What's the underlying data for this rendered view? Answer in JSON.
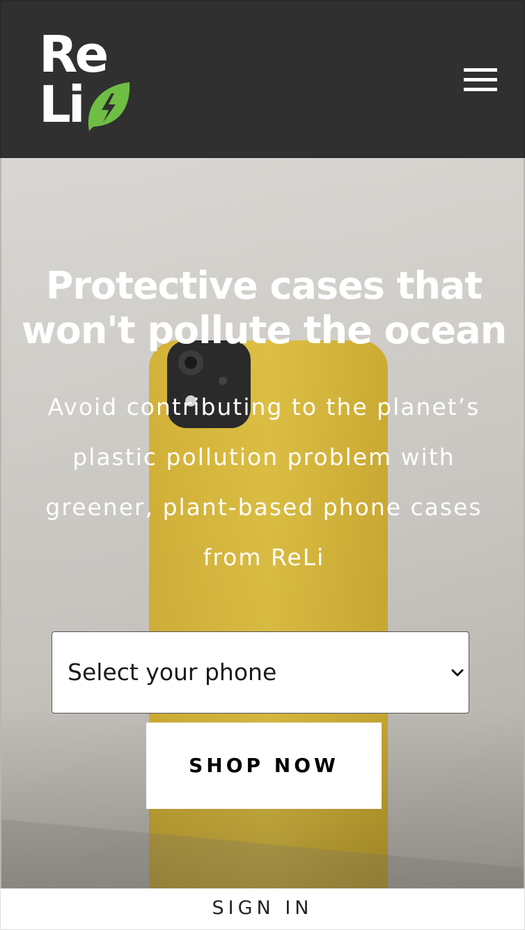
{
  "header": {
    "logo": {
      "line1": "Re",
      "line2": "Li",
      "accent_color": "#6fbe44"
    },
    "menu_icon": "hamburger-menu-icon",
    "background_color": "#303030"
  },
  "hero": {
    "title": "Protective cases that won't pollute the ocean",
    "text": "Avoid contributing to the planet’s plastic pollution problem with greener, plant-based phone cases from ReLi",
    "select": {
      "selected": "Select your phone",
      "icon": "chevron-down-icon"
    },
    "shop_button": "SHOP NOW"
  },
  "footer": {
    "sign_in": "SIGN IN"
  }
}
